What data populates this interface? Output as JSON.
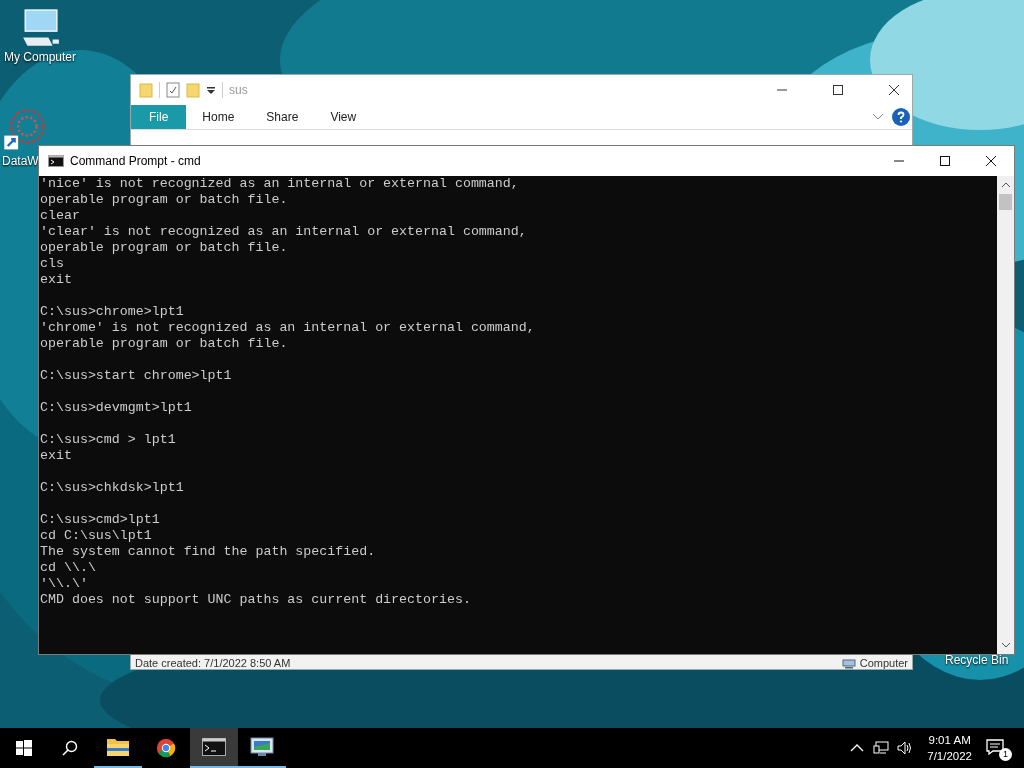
{
  "desktop_icons": [
    {
      "label": "My Computer",
      "kind": "computer"
    },
    {
      "label": "DataW",
      "kind": "shortcut"
    },
    {
      "label": "Recycle Bin",
      "kind": "recycle"
    }
  ],
  "explorer": {
    "title": "sus",
    "tabs": [
      {
        "label": "File",
        "selected": true
      },
      {
        "label": "Home",
        "selected": false
      },
      {
        "label": "Share",
        "selected": false
      },
      {
        "label": "View",
        "selected": false
      }
    ],
    "status": "Date created: 7/1/2022 8:50 AM",
    "location": "Computer"
  },
  "console": {
    "title": "Command Prompt - cmd",
    "blocks": [
      [
        "'nice' is not recognized as an internal or external command,",
        "operable program or batch file.",
        "clear",
        "'clear' is not recognized as an internal or external command,",
        "operable program or batch file.",
        "cls",
        "exit"
      ],
      [
        "C:\\sus>chrome>lpt1",
        "'chrome' is not recognized as an internal or external command,",
        "operable program or batch file."
      ],
      [
        "C:\\sus>start chrome>lpt1"
      ],
      [
        "C:\\sus>devmgmt>lpt1"
      ],
      [
        "C:\\sus>cmd > lpt1",
        "exit"
      ],
      [
        "C:\\sus>chkdsk>lpt1"
      ],
      [
        "C:\\sus>cmd>lpt1",
        "cd C:\\sus\\lpt1",
        "The system cannot find the path specified.",
        "cd \\\\.\\",
        "'\\\\.\\'",
        "CMD does not support UNC paths as current directories."
      ]
    ]
  },
  "taskbar": {
    "apps": [
      {
        "kind": "explorer",
        "running": true,
        "selected": false
      },
      {
        "kind": "chrome",
        "running": false,
        "selected": false
      },
      {
        "kind": "cmd",
        "running": true,
        "selected": true
      },
      {
        "kind": "remote",
        "running": true,
        "selected": false
      }
    ],
    "time": "9:01 AM",
    "date": "7/1/2022",
    "notifications": "1"
  }
}
